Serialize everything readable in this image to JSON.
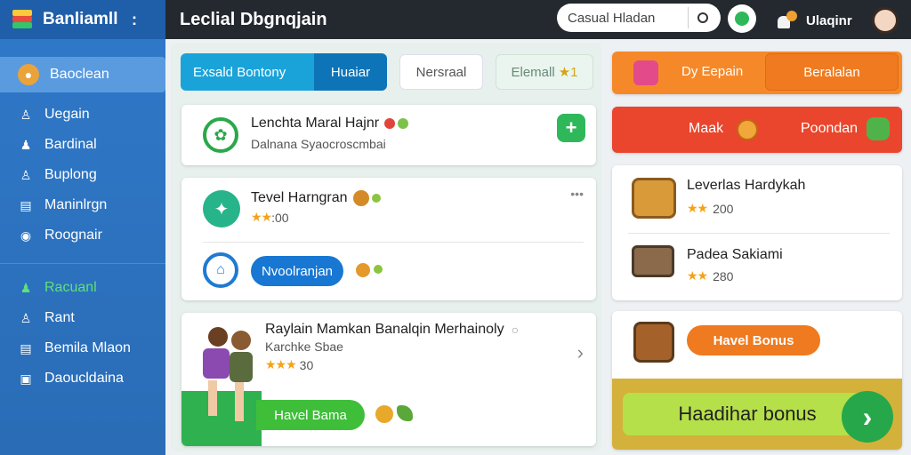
{
  "app": {
    "title": "Banliamll",
    "menu_glyph": ":"
  },
  "sidebar": {
    "items": [
      {
        "label": "Baoclean",
        "icon": "game-avatar-icon",
        "glyph": "●"
      },
      {
        "label": "Uegain",
        "icon": "user-icon",
        "glyph": "♙"
      },
      {
        "label": "Bardinal",
        "icon": "people-icon",
        "glyph": "♟"
      },
      {
        "label": "Buplong",
        "icon": "person-add-icon",
        "glyph": "♙"
      },
      {
        "label": "Maninlrgn",
        "icon": "document-icon",
        "glyph": "▤"
      },
      {
        "label": "Roognair",
        "icon": "target-icon",
        "glyph": "◉"
      },
      {
        "label": "Racuanl",
        "icon": "group-icon",
        "glyph": "♟"
      },
      {
        "label": "Rant",
        "icon": "user-icon",
        "glyph": "♙"
      },
      {
        "label": "Bemila Mlaon",
        "icon": "clipboard-icon",
        "glyph": "▤"
      },
      {
        "label": "Daoucldaina",
        "icon": "treasure-icon",
        "glyph": "▣"
      }
    ]
  },
  "topbar": {
    "title": "Leclial Dbgnqjain",
    "search_value": "Casual Hladan",
    "username": "Ulaqinr"
  },
  "tabs": [
    {
      "label": "Exsald Bontony"
    },
    {
      "label": "Huaiar"
    },
    {
      "label": "Nersraal"
    },
    {
      "label": "Elemall",
      "badge": "★1"
    }
  ],
  "games": [
    {
      "title": "Lenchta Maral Hajnr",
      "subtitle": "Dalnana Syaocroscmbai",
      "add_label": "+"
    },
    {
      "title": "Tevel Harngran",
      "rating": "★★",
      "score": ":00",
      "more": "•••"
    },
    {
      "button_label": "Nvoolranjan"
    },
    {
      "title": "Raylain Mamkan Banalqin Merhainoly",
      "subtitle": "Karchke Sbae",
      "rating": "★★★",
      "score": "30",
      "info": "○",
      "chevron": "›",
      "action_label": "Havel Bama"
    }
  ],
  "rewards": {
    "top_button_left": "Dy Eepain",
    "top_button_right": "Beralalan",
    "red_left": "Maak",
    "red_right": "Poondan",
    "items": [
      {
        "title": "Leverlas Hardykah",
        "rating": "★★",
        "score": "200"
      },
      {
        "title": "Padea Sakiami",
        "rating": "★★",
        "score": "280"
      }
    ],
    "bonus_pill": "Havel Bonus",
    "bonus_banner": "Haadihar bonus",
    "bonus_arrow": "›"
  },
  "colors": {
    "sidebar": "#2a6cb6",
    "topbar": "#24292f",
    "accent_green": "#2fb85a",
    "accent_orange": "#f07a1f",
    "accent_red": "#e9462d"
  }
}
